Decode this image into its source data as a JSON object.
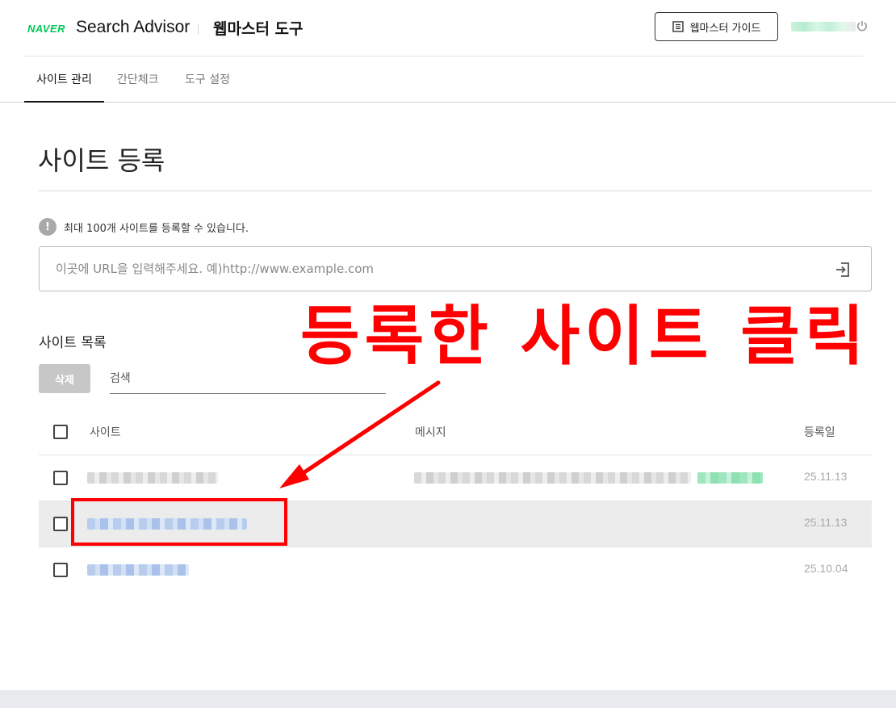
{
  "header": {
    "brand": "NAVER",
    "product": "Search Advisor",
    "title": "웹마스터 도구",
    "guide_button": "웹마스터 가이드",
    "guide_icon": "list-icon",
    "power_icon": "power-icon"
  },
  "tabs": [
    {
      "label": "사이트 관리",
      "active": true
    },
    {
      "label": "간단체크",
      "active": false
    },
    {
      "label": "도구 설정",
      "active": false
    }
  ],
  "main": {
    "title": "사이트 등록",
    "notice": "최대 100개 사이트를 등록할 수 있습니다.",
    "notice_icon": "info-icon",
    "url_input": {
      "placeholder": "이곳에 URL을 입력해주세요. 예)http://www.example.com",
      "value": "",
      "submit_icon": "enter-icon"
    }
  },
  "annotation": {
    "text": "등록한 사이트 클릭",
    "color": "#ff0000"
  },
  "site_list": {
    "title": "사이트 목록",
    "delete_button": "삭제",
    "search_placeholder": "검색",
    "columns": [
      "사이트",
      "메시지",
      "등록일"
    ],
    "rows": [
      {
        "date": "25.11.13",
        "selected": false
      },
      {
        "date": "25.11.13",
        "selected": true
      },
      {
        "date": "25.10.04",
        "selected": false
      }
    ]
  },
  "colors": {
    "brand": "#03c75a",
    "annotation": "#ff0000",
    "row_selected": "#ececec"
  }
}
